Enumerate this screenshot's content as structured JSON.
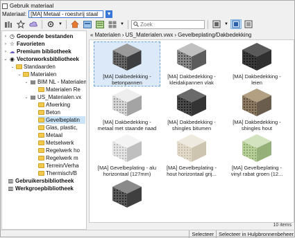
{
  "top": {
    "use_material_label": "Gebruik materiaal",
    "material_label": "Materiaal:",
    "material_value": "[MA] Metaal - roestvrij staal"
  },
  "toolbar": {
    "search_placeholder": "Zoek"
  },
  "tree": {
    "geopende": "Geopende bestanden",
    "favorieten": "Favorieten",
    "premium": "Premium bibliotheek",
    "vectorworks": "Vectorworksbibliotheek",
    "standaarden": "Standaarden",
    "materialen": "Materialen",
    "bim": "BIM NL - Materialen",
    "materialen_re": "Materialen Re",
    "us_materialen": "US_Materialen.vx",
    "afwerking": "Afwerking",
    "beton": "Beton",
    "gevelbeplating": "Gevelbeplatin",
    "glas": "Glas, plastic,",
    "metaal": "Metaal",
    "metselwerk": "Metselwerk",
    "regelwerk_h": "Regelwerk ho",
    "regelwerk_m": "Regelwerk m",
    "terrein": "Terrein/Verha",
    "thermisch": "Thermisch/B",
    "gebruikers": "Gebruikersbibliotheek",
    "werkgroep": "Werkgroepbibliotheek"
  },
  "path": {
    "p1": "Materialen",
    "p2": "US_Materialen.vwx",
    "p3": "Gevelbeplating/Dakbedekking"
  },
  "tiles": [
    {
      "line1": "[MA] Dakbedekking -",
      "line2": "betonpannen"
    },
    {
      "line1": "[MA] Dakbedekking -",
      "line2": "kleidakpannen vlak"
    },
    {
      "line1": "[MA] Dakbedekking -",
      "line2": "leien"
    },
    {
      "line1": "[MA] Dakbedekking -",
      "line2": "metaal met staande naad"
    },
    {
      "line1": "[MA] Dakbedekking -",
      "line2": "shingles bitumen"
    },
    {
      "line1": "[MA] Dakbedekking -",
      "line2": "shingles hout"
    },
    {
      "line1": "[MA] Gevelbeplating - alu",
      "line2": "horizontaal (127mm)"
    },
    {
      "line1": "[MA] Gevelbeplating -",
      "line2": "hout horizontaal grij..."
    },
    {
      "line1": "[MA] Gevelbeplating -",
      "line2": "vinyl rabat groen (12..."
    },
    {
      "line1": "",
      "line2": ""
    }
  ],
  "count": "10 items",
  "status": {
    "selecteer": "Selecteer",
    "selecteer_hulp": "Selecteer in Hulpbronnenbeheer"
  },
  "colors": {
    "accent": "#3a78d8",
    "selection": "#cce4f7"
  }
}
